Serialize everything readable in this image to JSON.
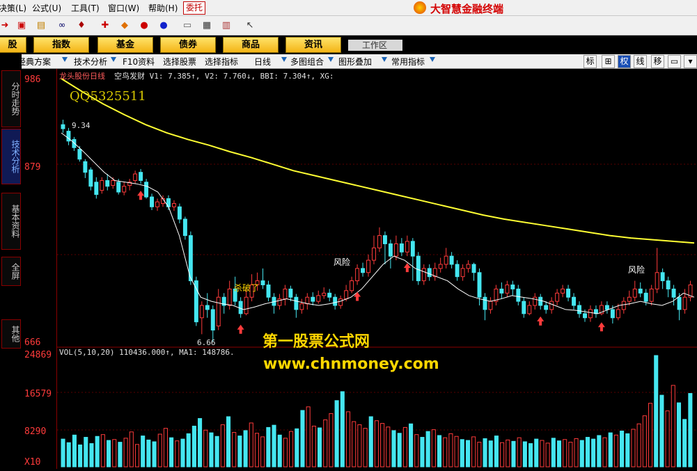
{
  "menu": {
    "items": [
      "决策(L)",
      "公式(U)",
      "工具(T)",
      "窗口(W)",
      "帮助(H)"
    ],
    "entrust": "委托",
    "brand": "大智慧金融终端"
  },
  "toolbar": {
    "icons": [
      "back-icon",
      "market-icon",
      "analysis-icon",
      "binoculars-icon",
      "alert-icon",
      "f10-icon",
      "diamond-icon",
      "stock-a-icon",
      "stock-b-icon",
      "notepad-icon",
      "list-icon",
      "books-icon",
      "help-pointer-icon"
    ]
  },
  "categories": {
    "items": [
      "股",
      "指数",
      "基金",
      "债券",
      "商品",
      "资讯"
    ],
    "workspace": "工作区"
  },
  "sidebar": {
    "tabs": [
      "分时走势",
      "技术分析",
      "基本资料",
      "全屏",
      "其他"
    ]
  },
  "chart_toolbar": {
    "items": [
      "经典方案",
      "技术分析",
      "F10资料",
      "选择股票",
      "选择指标",
      "日线",
      "多图组合",
      "图形叠加",
      "常用指标"
    ],
    "right_buttons": [
      "标",
      "⊞",
      "权",
      "线",
      "移",
      "▭",
      "▾"
    ]
  },
  "chart": {
    "title": "龙头股份日线",
    "indicator_line": "空鸟发财 V1: 7.385↑, V2: 7.760↓, BBI: 7.304↑, XG:",
    "high_marker": "9.34",
    "low_marker": "6.66",
    "labels_risk": [
      "风险",
      "风险"
    ],
    "label_kill": "杀破了",
    "vol_line": "VOL(5,10,20) 110436.000↑, MA1: 148786.",
    "qq": "QQ5325511",
    "watermark_title": "第一股票公式网",
    "watermark_url": "www.chnmoney.com"
  },
  "axis": {
    "price_labels": [
      "986",
      "879",
      "666"
    ],
    "volume_labels": [
      "24869",
      "16579",
      "8290"
    ],
    "volume_unit": "X10"
  },
  "colors": {
    "up": "#ff3b3b",
    "down": "#45e6f0",
    "bbi": "#ffff33",
    "ma": "#ffffff"
  },
  "chart_data": {
    "type": "candlestick",
    "ylim": [
      6.66,
      9.86
    ],
    "candles": [
      [
        9.3,
        9.25,
        9.36,
        9.2
      ],
      [
        9.22,
        9.1,
        9.26,
        9.05
      ],
      [
        9.12,
        9.02,
        9.15,
        8.98
      ],
      [
        9.0,
        8.88,
        9.04,
        8.85
      ],
      [
        8.85,
        8.72,
        8.88,
        8.65
      ],
      [
        8.75,
        8.55,
        8.78,
        8.5
      ],
      [
        8.6,
        8.45,
        8.66,
        8.4
      ],
      [
        8.5,
        8.62,
        8.66,
        8.46
      ],
      [
        8.62,
        8.55,
        8.7,
        8.5
      ],
      [
        8.56,
        8.62,
        8.66,
        8.52
      ],
      [
        8.6,
        8.48,
        8.64,
        8.45
      ],
      [
        8.48,
        8.55,
        8.6,
        8.44
      ],
      [
        8.56,
        8.6,
        8.64,
        8.5
      ],
      [
        8.62,
        8.7,
        8.74,
        8.58
      ],
      [
        8.72,
        8.62,
        8.76,
        8.58
      ],
      [
        8.6,
        8.42,
        8.64,
        8.4
      ],
      [
        8.42,
        8.3,
        8.46,
        8.26
      ],
      [
        8.3,
        8.36,
        8.4,
        8.25
      ],
      [
        8.34,
        8.4,
        8.44,
        8.3
      ],
      [
        8.4,
        8.3,
        8.44,
        8.26
      ],
      [
        8.3,
        8.34,
        8.38,
        8.25
      ],
      [
        8.3,
        8.15,
        8.34,
        8.1
      ],
      [
        8.15,
        7.95,
        8.18,
        7.9
      ],
      [
        7.95,
        7.4,
        8.0,
        7.35
      ],
      [
        7.4,
        6.9,
        7.45,
        6.85
      ],
      [
        6.95,
        7.1,
        7.15,
        6.75
      ],
      [
        7.1,
        7.05,
        7.25,
        6.95
      ],
      [
        7.05,
        6.8,
        7.1,
        6.66
      ],
      [
        6.85,
        7.2,
        7.3,
        6.8
      ],
      [
        7.2,
        7.1,
        7.25,
        7.0
      ],
      [
        7.1,
        7.3,
        7.4,
        7.05
      ],
      [
        7.3,
        7.15,
        7.45,
        7.1
      ],
      [
        7.15,
        7.0,
        7.2,
        6.95
      ],
      [
        7.0,
        7.2,
        7.3,
        6.98
      ],
      [
        7.2,
        7.35,
        7.48,
        7.15
      ],
      [
        7.35,
        7.4,
        7.5,
        7.28
      ],
      [
        7.4,
        7.35,
        7.55,
        7.3
      ],
      [
        7.35,
        7.2,
        7.4,
        7.15
      ],
      [
        7.2,
        7.1,
        7.25,
        7.0
      ],
      [
        7.1,
        7.18,
        7.24,
        7.05
      ],
      [
        7.18,
        7.3,
        7.35,
        7.1
      ],
      [
        7.3,
        7.2,
        7.34,
        7.15
      ],
      [
        7.2,
        7.05,
        7.24,
        6.95
      ],
      [
        7.05,
        7.12,
        7.18,
        7.0
      ],
      [
        7.12,
        7.2,
        7.25,
        7.05
      ],
      [
        7.2,
        7.15,
        7.26,
        7.1
      ],
      [
        7.15,
        7.22,
        7.28,
        7.12
      ],
      [
        7.22,
        7.25,
        7.32,
        7.18
      ],
      [
        7.25,
        7.2,
        7.3,
        7.15
      ],
      [
        7.2,
        7.1,
        7.24,
        7.05
      ],
      [
        7.1,
        7.18,
        7.22,
        7.06
      ],
      [
        7.18,
        7.28,
        7.35,
        7.15
      ],
      [
        7.28,
        7.4,
        7.45,
        7.25
      ],
      [
        7.4,
        7.55,
        7.6,
        7.35
      ],
      [
        7.55,
        7.5,
        7.62,
        7.45
      ],
      [
        7.5,
        7.65,
        7.72,
        7.45
      ],
      [
        7.65,
        7.8,
        7.95,
        7.6
      ],
      [
        7.8,
        7.95,
        8.05,
        7.75
      ],
      [
        7.95,
        7.85,
        8.0,
        7.6
      ],
      [
        7.85,
        7.7,
        7.9,
        7.55
      ],
      [
        7.7,
        7.85,
        7.95,
        7.65
      ],
      [
        7.85,
        7.75,
        7.92,
        7.7
      ],
      [
        7.75,
        7.88,
        7.95,
        7.7
      ],
      [
        7.88,
        7.7,
        7.92,
        7.4
      ],
      [
        7.7,
        7.4,
        7.75,
        7.35
      ],
      [
        7.4,
        7.55,
        7.6,
        7.35
      ],
      [
        7.55,
        7.45,
        7.6,
        7.4
      ],
      [
        7.45,
        7.55,
        7.62,
        7.4
      ],
      [
        7.55,
        7.6,
        7.68,
        7.5
      ],
      [
        7.6,
        7.7,
        7.8,
        7.55
      ],
      [
        7.7,
        7.6,
        7.75,
        7.55
      ],
      [
        7.6,
        7.45,
        7.65,
        7.4
      ],
      [
        7.45,
        7.55,
        7.6,
        7.4
      ],
      [
        7.55,
        7.6,
        7.65,
        7.5
      ],
      [
        7.6,
        7.5,
        7.62,
        7.4
      ],
      [
        7.5,
        7.2,
        7.55,
        7.1
      ],
      [
        7.2,
        7.05,
        7.25,
        6.92
      ],
      [
        7.05,
        7.15,
        7.2,
        7.0
      ],
      [
        7.15,
        7.3,
        7.35,
        7.1
      ],
      [
        7.3,
        7.25,
        7.38,
        7.18
      ],
      [
        7.25,
        7.35,
        7.4,
        7.2
      ],
      [
        7.35,
        7.3,
        7.4,
        7.22
      ],
      [
        7.3,
        7.15,
        7.35,
        7.1
      ],
      [
        7.15,
        7.0,
        7.2,
        6.95
      ],
      [
        7.0,
        7.1,
        7.15,
        6.98
      ],
      [
        7.1,
        7.2,
        7.25,
        7.05
      ],
      [
        7.2,
        7.1,
        7.24,
        7.05
      ],
      [
        7.1,
        7.05,
        7.15,
        7.0
      ],
      [
        7.05,
        7.15,
        7.2,
        7.0
      ],
      [
        7.15,
        7.25,
        7.3,
        7.1
      ],
      [
        7.25,
        7.3,
        7.35,
        7.2
      ],
      [
        7.3,
        7.2,
        7.35,
        7.15
      ],
      [
        7.2,
        7.1,
        7.25,
        7.05
      ],
      [
        7.1,
        7.0,
        7.15,
        6.95
      ],
      [
        7.0,
        6.95,
        7.05,
        6.9
      ],
      [
        6.95,
        7.05,
        7.1,
        6.9
      ],
      [
        7.05,
        7.0,
        7.1,
        6.95
      ],
      [
        7.0,
        7.1,
        7.15,
        6.98
      ],
      [
        7.1,
        7.05,
        7.15,
        7.0
      ],
      [
        7.05,
        6.95,
        7.1,
        6.88
      ],
      [
        6.95,
        7.05,
        7.12,
        6.92
      ],
      [
        7.05,
        7.15,
        7.2,
        7.0
      ],
      [
        7.15,
        7.2,
        7.28,
        7.1
      ],
      [
        7.2,
        7.3,
        7.4,
        7.15
      ],
      [
        7.3,
        7.25,
        7.38,
        7.2
      ],
      [
        7.25,
        7.15,
        7.3,
        7.1
      ],
      [
        7.15,
        7.3,
        7.35,
        7.1
      ],
      [
        7.3,
        7.5,
        7.8,
        7.25
      ],
      [
        7.5,
        7.4,
        7.55,
        7.3
      ],
      [
        7.4,
        7.3,
        7.45,
        7.2
      ],
      [
        7.3,
        7.2,
        7.35,
        7.1
      ],
      [
        7.2,
        7.05,
        7.25,
        6.92
      ],
      [
        7.05,
        7.2,
        7.3,
        7.0
      ],
      [
        7.2,
        7.35,
        7.4,
        7.15
      ]
    ],
    "bbi": [
      9.86,
      9.7,
      9.55,
      9.42,
      9.3,
      9.2,
      9.12,
      9.05,
      8.97,
      8.9,
      8.82,
      8.74,
      8.68,
      8.62,
      8.56,
      8.5,
      8.44,
      8.38,
      8.32,
      8.26,
      8.2,
      8.15,
      8.11,
      8.07,
      8.03,
      7.99,
      7.95,
      7.92,
      7.9,
      7.88,
      7.86
    ],
    "ma": [
      9.2,
      9.1,
      8.98,
      8.85,
      8.72,
      8.62,
      8.6,
      8.58,
      8.55,
      8.48,
      8.3,
      7.95,
      7.45,
      7.2,
      7.15,
      7.12,
      7.1,
      7.05,
      7.08,
      7.12,
      7.15,
      7.18,
      7.15,
      7.12,
      7.1,
      7.12,
      7.15,
      7.2,
      7.3,
      7.45,
      7.6,
      7.7,
      7.65,
      7.55,
      7.5,
      7.45,
      7.4,
      7.3,
      7.22,
      7.18,
      7.15,
      7.18,
      7.22,
      7.2,
      7.18,
      7.15,
      7.1,
      7.05,
      7.04,
      7.02,
      7.0,
      7.05,
      7.1,
      7.12,
      7.15,
      7.12,
      7.1,
      7.15,
      7.25,
      7.2
    ],
    "volume": [
      6200,
      5400,
      7100,
      4900,
      6600,
      5200,
      6800,
      7200,
      5900,
      6100,
      5500,
      6400,
      7800,
      5000,
      6900,
      6000,
      5600,
      7300,
      8600,
      6500,
      5800,
      6200,
      7400,
      9100,
      10800,
      8200,
      7600,
      6800,
      9400,
      11200,
      7700,
      6900,
      8100,
      9800,
      7500,
      6700,
      8800,
      9300,
      7100,
      6400,
      7900,
      8500,
      12600,
      13400,
      9100,
      8700,
      10500,
      11900,
      14800,
      16800,
      12300,
      10100,
      9400,
      8600,
      11200,
      10300,
      9700,
      8900,
      8100,
      7500,
      8800,
      9600,
      7200,
      6600,
      7900,
      8300,
      7000,
      6500,
      7400,
      6800,
      6100,
      5900,
      6700,
      5500,
      6300,
      5800,
      6900,
      5400,
      6000,
      5700,
      6500,
      5600,
      5200,
      6200,
      5900,
      5300,
      6400,
      5800,
      6100,
      5500,
      6300,
      5900,
      6600,
      6200,
      7000,
      6500,
      7600,
      7100,
      8000,
      7400,
      8400,
      9600,
      11400,
      14200,
      24869,
      16000,
      12500,
      18200,
      14300,
      10600,
      16400
    ]
  }
}
